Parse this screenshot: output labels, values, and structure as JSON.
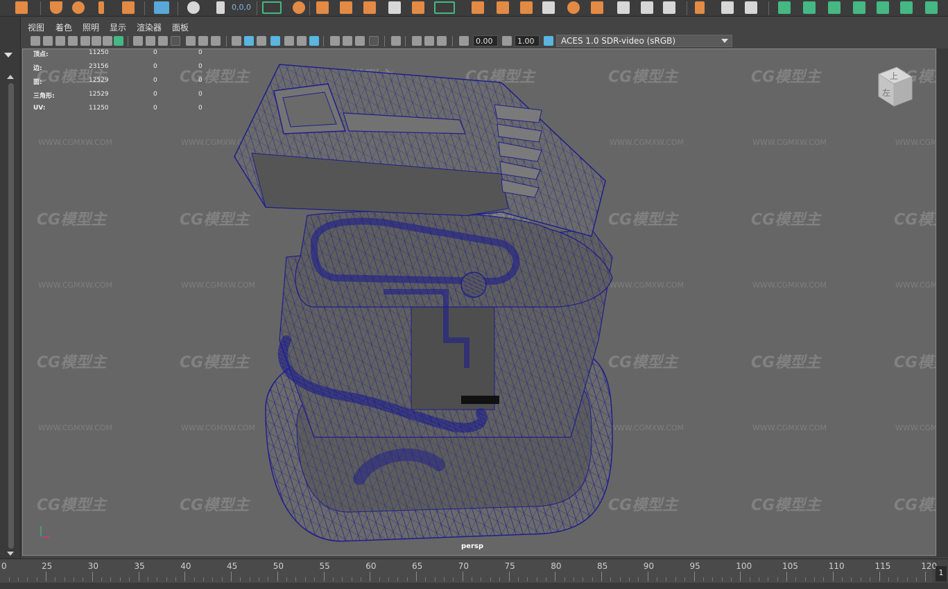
{
  "panel_menu": [
    "视图",
    "着色",
    "照明",
    "显示",
    "渲染器",
    "面板"
  ],
  "shelf": {
    "coord_readout": "0,0,0"
  },
  "toolbar": {
    "exposure_value": "0.00",
    "gamma_value": "1.00",
    "color_space": "ACES 1.0 SDR-video (sRGB)"
  },
  "hud": {
    "rows": [
      {
        "label": "顶点:",
        "v1": "11250",
        "v2": "0",
        "v3": "0"
      },
      {
        "label": "边:",
        "v1": "23156",
        "v2": "0",
        "v3": "0"
      },
      {
        "label": "面:",
        "v1": "12529",
        "v2": "0",
        "v3": "0"
      },
      {
        "label": "三角形:",
        "v1": "12529",
        "v2": "0",
        "v3": "0"
      },
      {
        "label": "UV:",
        "v1": "11250",
        "v2": "0",
        "v3": "0"
      }
    ]
  },
  "viewport": {
    "camera_label": "persp",
    "viewcube_top": "上",
    "viewcube_left": "左"
  },
  "watermark": {
    "logo": "CG模型主",
    "url": "WWW.CGMXW.COM"
  },
  "timeslider": {
    "ticks": [
      "0",
      "25",
      "30",
      "35",
      "40",
      "45",
      "50",
      "55",
      "60",
      "65",
      "70",
      "75",
      "80",
      "85",
      "90",
      "95",
      "100",
      "105",
      "110",
      "115",
      "120"
    ],
    "current_frame": "1"
  },
  "colors": {
    "viewport_bg": "#666666",
    "wire": "#1e1e8c",
    "shelf_orange": "#e38a45",
    "shelf_green": "#45b883",
    "accent_blue": "#5ab5e0"
  }
}
